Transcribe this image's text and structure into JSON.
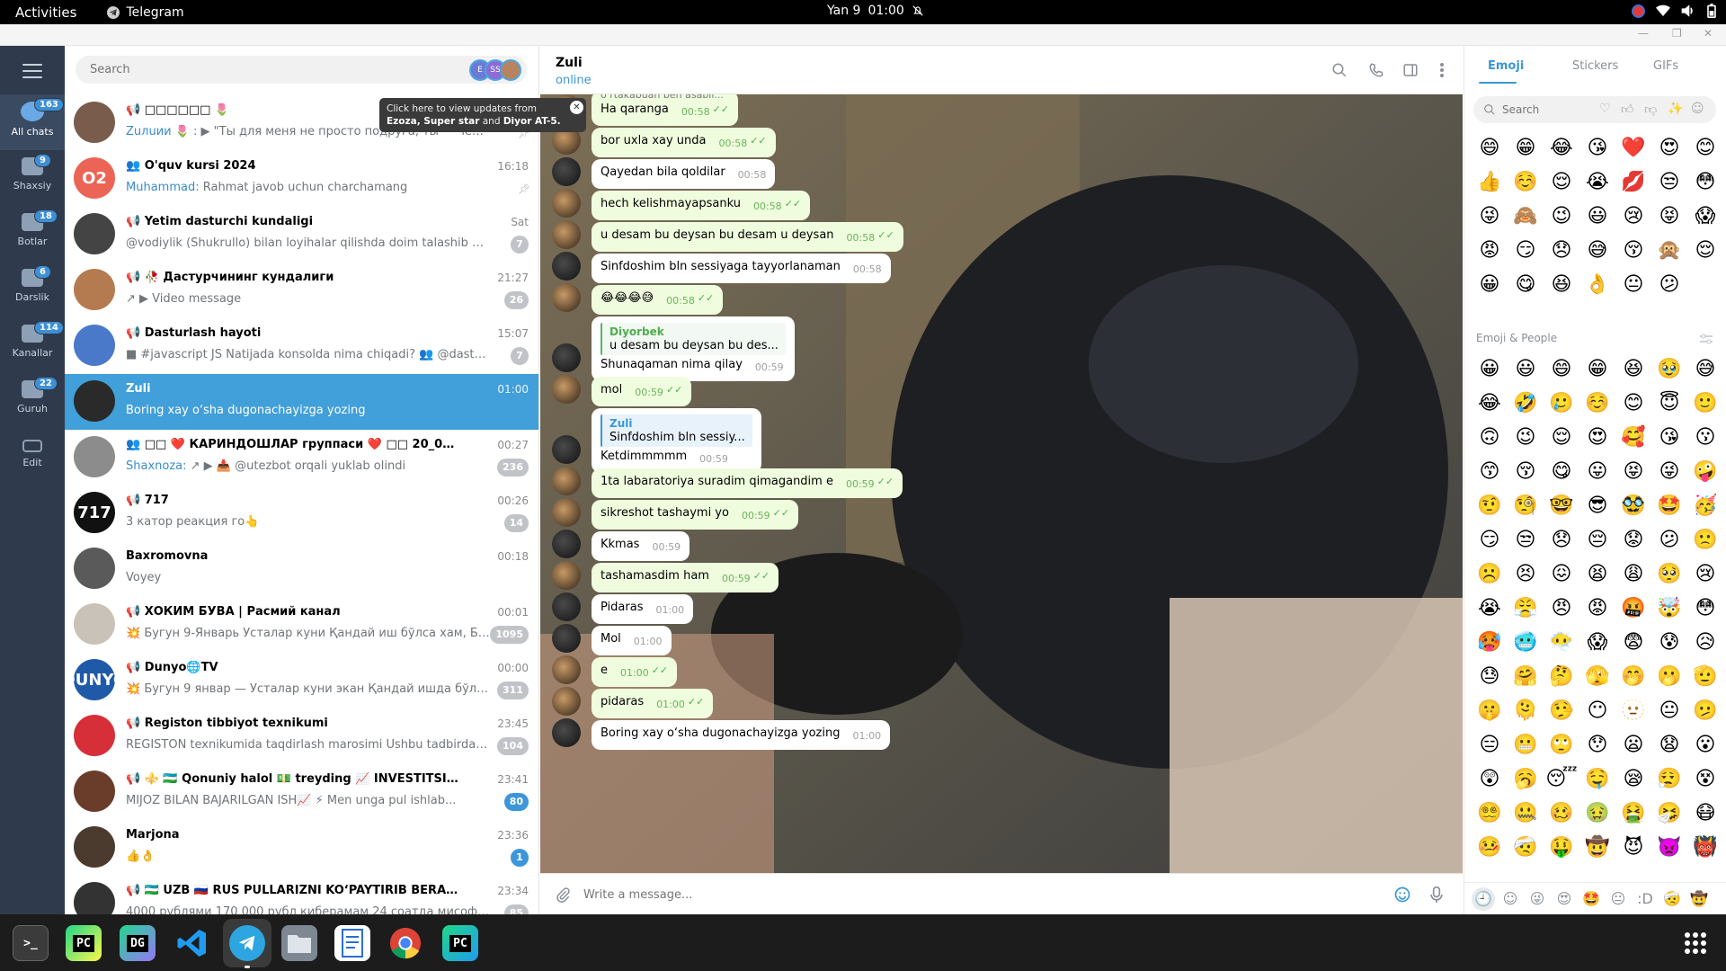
{
  "topbar": {
    "activities": "Activities",
    "app": "Telegram",
    "date": "Yan 9",
    "time": "01:00"
  },
  "rail": {
    "folders": [
      {
        "label": "All chats",
        "badge": "163"
      },
      {
        "label": "Shaxsiy",
        "badge": "9"
      },
      {
        "label": "Botlar",
        "badge": "18"
      },
      {
        "label": "Darslik",
        "badge": "6"
      },
      {
        "label": "Kanallar",
        "badge": "114"
      },
      {
        "label": "Guruh",
        "badge": "22"
      },
      {
        "label": "Edit",
        "badge": ""
      }
    ]
  },
  "search": {
    "placeholder": "Search",
    "story_avatars": [
      "E",
      "SS",
      ""
    ],
    "tooltip_prefix": "Click here to view updates from",
    "tooltip_names": "Ezoza, Super star",
    "tooltip_and": "and",
    "tooltip_last": "Diyor AT-5."
  },
  "chats": [
    {
      "name": "📢 □□□□□□ 🌷",
      "time": "",
      "sender": "Zuлuии 🌷 :",
      "preview": " ▶ \"Ты для меня не просто подруга, ты — человек, ко...",
      "badge": "",
      "pinned": true,
      "initials": "",
      "color": "#7a5c4c"
    },
    {
      "name": "👥 O'quv kursi 2024",
      "time": "16:18",
      "sender": "Muhammad:",
      "preview": " Rahmat javob uchun charchamang",
      "badge": "",
      "pinned": true,
      "initials": "O2",
      "color": "#ec6456"
    },
    {
      "name": "📢 Yetim dasturchi kundaligi",
      "time": "Sat",
      "sender": "",
      "preview": "@vodiylik (Shukrullo) bilan loyihalar qilishda doim talashib yursak ha...",
      "badge": "7",
      "pinned": false,
      "initials": "",
      "color": "#444444"
    },
    {
      "name": "📢 🥀 Дастурчининг кундалиги",
      "time": "21:27",
      "sender": "",
      "preview": "↗ ▶ Video message",
      "badge": "26",
      "pinned": false,
      "initials": "",
      "color": "#b57b50"
    },
    {
      "name": "📢 Dasturlash hayoti",
      "time": "15:07",
      "sender": "",
      "preview": "■ #javascript  JS Natijada konsolda nima chiqadi? 👥 @dasturlas...",
      "badge": "7",
      "pinned": false,
      "initials": "",
      "color": "#4a79c9"
    },
    {
      "name": "Zuli",
      "time": "01:00",
      "sender": "",
      "preview": "Boring xay o‘sha dugonachayizga yozing",
      "badge": "",
      "pinned": false,
      "initials": "",
      "color": "#2a2a2a"
    },
    {
      "name": "👥 □□ ❤️ КАРИНДОШЛАР группаси ❤️ □□ 20_06_2024_",
      "time": "00:27",
      "sender": "Shaxnoza:",
      "preview": " ↗ ▶ 📥 @utezbot orqali yuklab olindi",
      "badge": "236",
      "pinned": false,
      "initials": "",
      "color": "#8c8c8c"
    },
    {
      "name": "📢 717",
      "time": "00:26",
      "sender": "",
      "preview": "3 катор реакция го👆",
      "badge": "14",
      "pinned": false,
      "initials": "717",
      "color": "#111111"
    },
    {
      "name": "Baxromovna",
      "time": "00:18",
      "sender": "",
      "preview": "Voyey",
      "badge": "",
      "pinned": false,
      "initials": "",
      "color": "#5a5a5a"
    },
    {
      "name": "📢 ХОКИМ БУВА | Расмий канал",
      "time": "00:01",
      "sender": "",
      "preview": "💥 Бугун 9-Январь Усталар куни  Қандай иш бўлса хам, Бар...",
      "badge": "1095",
      "pinned": false,
      "initials": "",
      "color": "#c9c2b8"
    },
    {
      "name": "📢 Dunyo🌐TV",
      "time": "00:00",
      "sender": "",
      "preview": "💥 Бугун 9 январ — Усталар куни экан  Қандай ишда бўлса х...",
      "badge": "311",
      "pinned": false,
      "initials": "DUNYO",
      "color": "#1e5aa8"
    },
    {
      "name": "📢 Registon tibbiyot texnikumi",
      "time": "23:45",
      "sender": "",
      "preview": "REGISTON texnikumida taqdirlash marosimi  Ushbu tadbirda bili...",
      "badge": "104",
      "pinned": false,
      "initials": "",
      "color": "#d62f3a"
    },
    {
      "name": "📢 ⚜️ 🇺🇿 Qonuniy halol 💵 treyding 📈 INVESTITSIYA 📈 meneg...",
      "time": "23:41",
      "sender": "",
      "preview": "MIJOZ BILAN BAJARILGAN ISH📈  ⚡ Men unga pul ishlab...",
      "badge": "80",
      "pinned": false,
      "initials": "",
      "color": "#6a3d2a"
    },
    {
      "name": "Marjona",
      "time": "23:36",
      "sender": "",
      "preview": "👍👌",
      "badge": "1",
      "pinned": false,
      "initials": "",
      "color": "#4b3a2e"
    },
    {
      "name": "📢 🇺🇿 UZB 🇷🇺 RUS PULLARIZNI KO‘PAYTIRIB BERAMIZA 💸💸 I...",
      "time": "23:34",
      "sender": "",
      "preview": "4000 рублями 170 000 рубл киберамам 24 соатда мисофиод...",
      "badge": "85",
      "pinned": false,
      "initials": "",
      "color": "#333333"
    }
  ],
  "conversation": {
    "name": "Zuli",
    "status": "online",
    "messages": [
      {
        "out": true,
        "text": "Ha qaranga",
        "time": "00:58",
        "quoted": "o‘rtakabuan ben asabii..."
      },
      {
        "out": true,
        "text": "bor uxla xay unda",
        "time": "00:58"
      },
      {
        "out": false,
        "text": "Qayedan bila qoldilar",
        "time": "00:58"
      },
      {
        "out": true,
        "text": "hech kelishmayapsanku",
        "time": "00:58"
      },
      {
        "out": true,
        "text": "u desam bu deysan bu desam u deysan",
        "time": "00:58"
      },
      {
        "out": false,
        "text": "Sinfdoshim bln sessiyaga tayyorlanaman",
        "time": "00:58"
      },
      {
        "out": true,
        "text": "😂😂😂😅",
        "time": "00:58"
      },
      {
        "out": false,
        "reply_name": "Diyorbek",
        "reply_text": "u desam bu deysan bu des...",
        "text": "Shunaqaman nima qilay",
        "time": "00:59"
      },
      {
        "out": true,
        "text": "mol",
        "time": "00:59"
      },
      {
        "out": false,
        "reply_name": "Zuli",
        "reply_text": "Sinfdoshim bln sessiy...",
        "text": "Ketdimmmmm",
        "time": "00:59"
      },
      {
        "out": true,
        "text": "1ta labaratoriya suradim qimagandim e",
        "time": "00:59"
      },
      {
        "out": true,
        "text": "sikreshot tashaymi yo",
        "time": "00:59"
      },
      {
        "out": false,
        "text": "Kkmas",
        "time": "00:59"
      },
      {
        "out": true,
        "text": "tashamasdim ham",
        "time": "00:59"
      },
      {
        "out": false,
        "text": "Pidaras",
        "time": "01:00"
      },
      {
        "out": false,
        "text": "Mol",
        "time": "01:00"
      },
      {
        "out": true,
        "text": "e",
        "time": "01:00"
      },
      {
        "out": true,
        "text": "pidaras",
        "time": "01:00"
      },
      {
        "out": false,
        "text": "Boring xay o‘sha dugonachayizga yozing",
        "time": "01:00"
      }
    ]
  },
  "composer": {
    "placeholder": "Write a message..."
  },
  "emoji_panel": {
    "tabs": [
      "Emoji",
      "Stickers",
      "GIFs"
    ],
    "search_placeholder": "Search",
    "section_title": "Emoji & People",
    "recent": [
      "😄",
      "😁",
      "😂",
      "😘",
      "❤️",
      "😍",
      "😊",
      "👍",
      "☺️",
      "😌",
      "😭",
      "💋",
      "😒",
      "😳",
      "😜",
      "🙈",
      "😉",
      "😃",
      "😢",
      "😝",
      "😱",
      "😡",
      "😏",
      "😞",
      "😅",
      "😚",
      "🙊",
      "😌",
      "😀",
      "😋",
      "😆",
      "👌",
      "😐",
      "😕"
    ],
    "people": [
      "😀",
      "😃",
      "😄",
      "😁",
      "😆",
      "🥹",
      "😅",
      "😂",
      "🤣",
      "🥲",
      "☺️",
      "😊",
      "😇",
      "🙂",
      "🙃",
      "😉",
      "😌",
      "😍",
      "🥰",
      "😘",
      "😗",
      "😙",
      "😚",
      "😋",
      "😛",
      "😝",
      "😜",
      "🤪",
      "🤨",
      "🧐",
      "🤓",
      "😎",
      "🥸",
      "🤩",
      "🥳",
      "😏",
      "😒",
      "😞",
      "😔",
      "😟",
      "😕",
      "🙁",
      "☹️",
      "😣",
      "😖",
      "😫",
      "😩",
      "🥺",
      "😢",
      "😭",
      "😤",
      "😠",
      "😡",
      "🤬",
      "🤯",
      "😳",
      "🥵",
      "🥶",
      "😶‍🌫️",
      "😱",
      "😨",
      "😰",
      "😥",
      "😓",
      "🤗",
      "🤔",
      "🫣",
      "🤭",
      "🫢",
      "🫡",
      "🤫",
      "🫠",
      "🤥",
      "😶",
      "🫥",
      "😐",
      "🫤",
      "😑",
      "😬",
      "🙄",
      "😯",
      "😦",
      "😧",
      "😮",
      "😲",
      "🥱",
      "😴",
      "🤤",
      "😪",
      "😮‍💨",
      "😵",
      "😵‍💫",
      "🤐",
      "🥴",
      "🤢",
      "🤮",
      "🤧",
      "😷",
      "🤒",
      "🤕",
      "🤑",
      "🤠",
      "😈",
      "👿",
      "👹",
      "👺",
      "🤡",
      "💩",
      "👻"
    ],
    "bottom": [
      "🕘",
      "☺",
      "😜",
      "😍",
      "🤩",
      "😐",
      ":D",
      "🤕",
      "🤠"
    ]
  }
}
